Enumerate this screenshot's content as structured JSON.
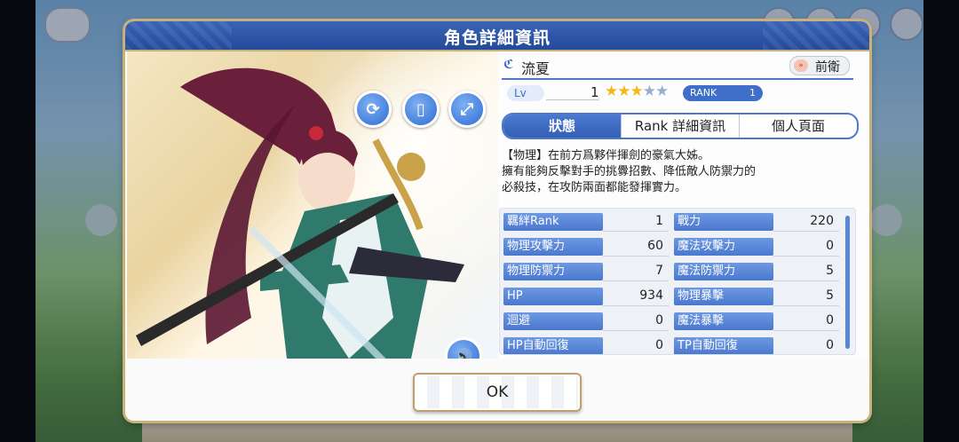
{
  "dialog": {
    "title": "角色詳細資訊"
  },
  "character": {
    "name": "流夏",
    "role": "前衛",
    "lv_label": "Lv",
    "level": "1",
    "stars_filled": 3,
    "stars_total": 5,
    "rank_label": "RANK",
    "rank_value": "1"
  },
  "tabs": [
    {
      "label": "狀態",
      "active": true
    },
    {
      "label": "Rank 詳細資訊",
      "active": false
    },
    {
      "label": "個人頁面",
      "active": false
    }
  ],
  "description": [
    "【物理】在前方爲夥伴揮劍的豪氣大姊。",
    "擁有能夠反擊對手的挑釁招數、降低敵人防禦力的",
    "必殺技，在攻防兩面都能發揮實力。"
  ],
  "stats": [
    [
      {
        "label": "羈絆Rank",
        "value": "1"
      },
      {
        "label": "戰力",
        "value": "220"
      }
    ],
    [
      {
        "label": "物理攻擊力",
        "value": "60"
      },
      {
        "label": "魔法攻擊力",
        "value": "0"
      }
    ],
    [
      {
        "label": "物理防禦力",
        "value": "7"
      },
      {
        "label": "魔法防禦力",
        "value": "5"
      }
    ],
    [
      {
        "label": "HP",
        "value": "934"
      },
      {
        "label": "物理暴擊",
        "value": "5"
      }
    ],
    [
      {
        "label": "迴避",
        "value": "0"
      },
      {
        "label": "魔法暴擊",
        "value": "0"
      }
    ],
    [
      {
        "label": "HP自動回復",
        "value": "0"
      },
      {
        "label": "TP自動回復",
        "value": "0"
      }
    ]
  ],
  "buttons": {
    "ok": "OK"
  },
  "icons": {
    "rotate": "rotate-icon",
    "card": "card-icon",
    "expand": "expand-icon",
    "voice": "speaker-icon"
  },
  "colors": {
    "accent": "#3d6cc3",
    "header": "#2d55a8",
    "star": "#f3b81b",
    "frame": "#c9b27a"
  }
}
